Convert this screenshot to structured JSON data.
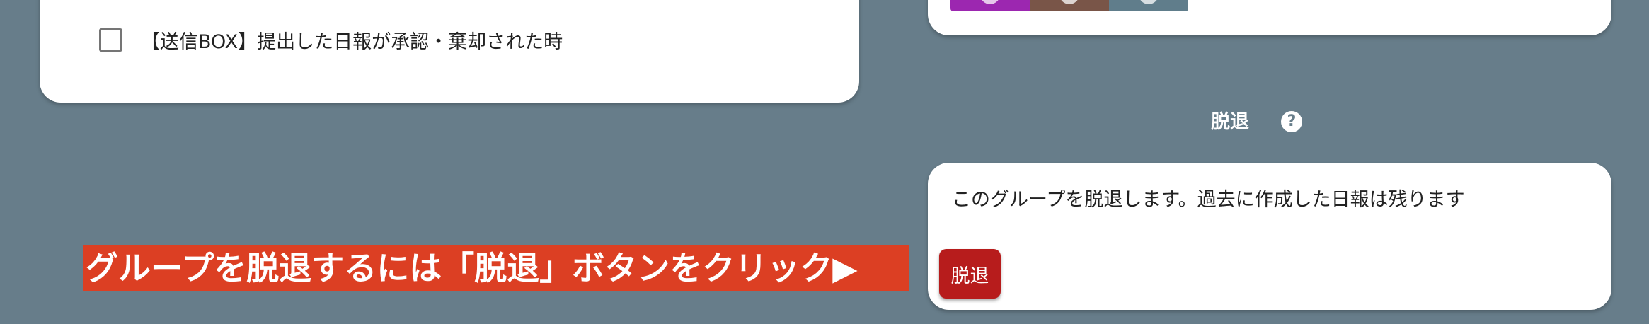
{
  "notifications": {
    "sent_box_label": "【送信BOX】提出した日報が承認・棄却された時"
  },
  "theme_palette": {
    "colors": [
      "#9c27b0",
      "#795548",
      "#607d8b"
    ]
  },
  "leave_section": {
    "title": "脱退",
    "help_icon": "?",
    "description": "このグループを脱退します。過去に作成した日報は残ります",
    "button_label": "脱退"
  },
  "annotation": {
    "text": "グループを脱退するには「脱退」ボタンをクリック▶"
  }
}
